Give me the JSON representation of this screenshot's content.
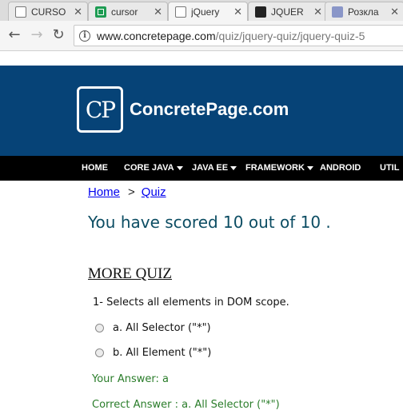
{
  "browser": {
    "tabs": [
      {
        "title": "CURSO",
        "icon": "document-icon"
      },
      {
        "title": "cursor",
        "icon": "sheets-icon"
      },
      {
        "title": "jQuery",
        "icon": "document-icon"
      },
      {
        "title": "JQUER",
        "icon": "github-icon"
      },
      {
        "title": "Розкла",
        "icon": "circle-icon"
      }
    ],
    "close_glyph": "✕",
    "back_glyph": "←",
    "forward_glyph": "→",
    "reload_glyph": "↻",
    "info_glyph": "i",
    "url_host": "www.concretepage.com",
    "url_path": "/quiz/jquery-quiz/jquery-quiz-5"
  },
  "site": {
    "logo_text": "CP",
    "title": "ConcretePage.com",
    "header_color": "#064377",
    "menu": [
      {
        "label": "HOME",
        "dropdown": false
      },
      {
        "label": "CORE JAVA",
        "dropdown": true
      },
      {
        "label": "JAVA EE",
        "dropdown": true
      },
      {
        "label": "FRAMEWORK",
        "dropdown": true
      },
      {
        "label": "ANDROID",
        "dropdown": false
      },
      {
        "label": "UTIL",
        "dropdown": false
      }
    ]
  },
  "content": {
    "breadcrumb": {
      "home": "Home",
      "separator": ">",
      "current": "Quiz"
    },
    "score_text": "You have scored 10 out of 10 .",
    "section_title": "MORE QUIZ",
    "question": "1- Selects all elements in DOM scope.",
    "options": [
      "a. All Selector (\"*\")",
      "b. All Element (\"*\")"
    ],
    "your_answer": "Your Answer: a",
    "correct_answer": "Correct Answer : a. All Selector (\"*\")",
    "answer_color": "#2a7d2a"
  }
}
